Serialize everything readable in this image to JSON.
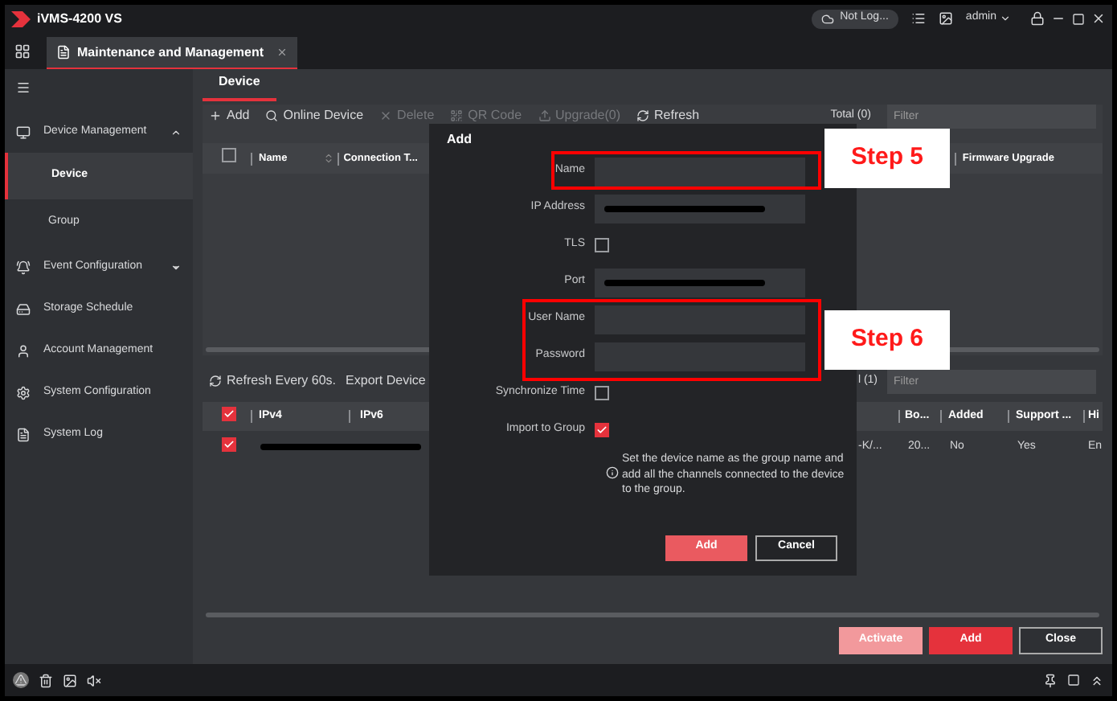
{
  "window": {
    "title": "iVMS-4200 VS",
    "cloud_status": "Not Log...",
    "user": "admin"
  },
  "tabs": [
    {
      "label": "Maintenance and Management",
      "selected": true
    }
  ],
  "sidebar": {
    "items": [
      {
        "label": "Device Management",
        "expanded": true,
        "children": [
          {
            "label": "Device",
            "selected": true
          },
          {
            "label": "Group",
            "selected": false
          }
        ]
      },
      {
        "label": "Event Configuration",
        "expanded": false
      },
      {
        "label": "Storage Schedule"
      },
      {
        "label": "Account Management"
      },
      {
        "label": "System Configuration"
      },
      {
        "label": "System Log"
      }
    ]
  },
  "subtabs": [
    {
      "label": "Device",
      "selected": true
    }
  ],
  "toolbar": [
    {
      "label": "Add",
      "disabled": false
    },
    {
      "label": "Online Device",
      "disabled": false
    },
    {
      "label": "Delete",
      "disabled": true
    },
    {
      "label": "QR Code",
      "disabled": true
    },
    {
      "label": "Upgrade(0)",
      "disabled": true
    },
    {
      "label": "Refresh",
      "disabled": false
    }
  ],
  "device_table": {
    "total": "Total (0)",
    "filter_placeholder": "Filter",
    "select_all": false,
    "columns": [
      "Name",
      "Connection T...",
      "Firmware Upgrade"
    ]
  },
  "online_section": {
    "refresh": "Refresh Every 60s.",
    "export": "Export Device",
    "total": "l (1)",
    "filter_placeholder": "Filter",
    "select_all": true,
    "columns": [
      "IPv4",
      "IPv6",
      "Bo...",
      "Added",
      "Support ...",
      "Hi"
    ],
    "rows": [
      {
        "checked": true,
        "column_3": "-K/...",
        "boot": "20...",
        "added": "No",
        "support": "Yes",
        "column_7": "En"
      }
    ]
  },
  "dialog": {
    "title": "Add",
    "fields": [
      {
        "kind": "input",
        "label": "Name",
        "redacted": false
      },
      {
        "kind": "input",
        "label": "IP Address",
        "redacted": true
      },
      {
        "kind": "checkbox",
        "label": "TLS",
        "checked": false
      },
      {
        "kind": "input",
        "label": "Port",
        "redacted": true
      },
      {
        "kind": "input",
        "label": "User Name",
        "redacted": false
      },
      {
        "kind": "input",
        "label": "Password",
        "redacted": false
      },
      {
        "kind": "checkbox",
        "label": "Synchronize Time",
        "checked": false
      },
      {
        "kind": "checkbox",
        "label": "Import to Group",
        "checked": true
      }
    ],
    "info": "Set the device name as the group name and add all the channels connected to the device to the group.",
    "buttons": [
      {
        "label": "Add",
        "kind": "primary"
      },
      {
        "label": "Cancel",
        "kind": "secondary"
      }
    ]
  },
  "footer_buttons": [
    {
      "label": "Activate",
      "kind": "primary",
      "disabled": true
    },
    {
      "label": "Add",
      "kind": "primary",
      "disabled": false
    },
    {
      "label": "Close",
      "kind": "secondary",
      "disabled": false
    }
  ],
  "annotations": [
    {
      "label": "Step 5"
    },
    {
      "label": "Step 6"
    }
  ]
}
